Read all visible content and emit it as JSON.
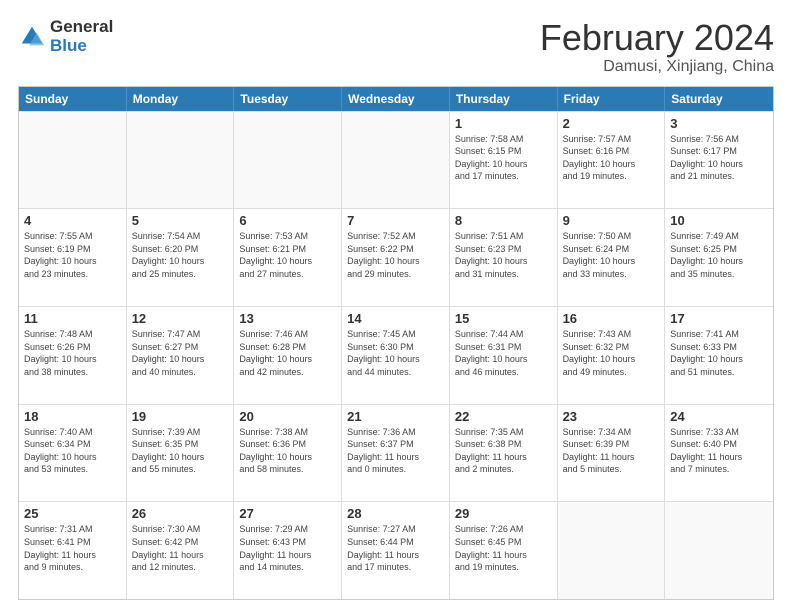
{
  "header": {
    "logo_general": "General",
    "logo_blue": "Blue",
    "title": "February 2024",
    "location": "Damusi, Xinjiang, China"
  },
  "calendar": {
    "days_of_week": [
      "Sunday",
      "Monday",
      "Tuesday",
      "Wednesday",
      "Thursday",
      "Friday",
      "Saturday"
    ],
    "weeks": [
      [
        {
          "day": "",
          "info": ""
        },
        {
          "day": "",
          "info": ""
        },
        {
          "day": "",
          "info": ""
        },
        {
          "day": "",
          "info": ""
        },
        {
          "day": "1",
          "info": "Sunrise: 7:58 AM\nSunset: 6:15 PM\nDaylight: 10 hours\nand 17 minutes."
        },
        {
          "day": "2",
          "info": "Sunrise: 7:57 AM\nSunset: 6:16 PM\nDaylight: 10 hours\nand 19 minutes."
        },
        {
          "day": "3",
          "info": "Sunrise: 7:56 AM\nSunset: 6:17 PM\nDaylight: 10 hours\nand 21 minutes."
        }
      ],
      [
        {
          "day": "4",
          "info": "Sunrise: 7:55 AM\nSunset: 6:19 PM\nDaylight: 10 hours\nand 23 minutes."
        },
        {
          "day": "5",
          "info": "Sunrise: 7:54 AM\nSunset: 6:20 PM\nDaylight: 10 hours\nand 25 minutes."
        },
        {
          "day": "6",
          "info": "Sunrise: 7:53 AM\nSunset: 6:21 PM\nDaylight: 10 hours\nand 27 minutes."
        },
        {
          "day": "7",
          "info": "Sunrise: 7:52 AM\nSunset: 6:22 PM\nDaylight: 10 hours\nand 29 minutes."
        },
        {
          "day": "8",
          "info": "Sunrise: 7:51 AM\nSunset: 6:23 PM\nDaylight: 10 hours\nand 31 minutes."
        },
        {
          "day": "9",
          "info": "Sunrise: 7:50 AM\nSunset: 6:24 PM\nDaylight: 10 hours\nand 33 minutes."
        },
        {
          "day": "10",
          "info": "Sunrise: 7:49 AM\nSunset: 6:25 PM\nDaylight: 10 hours\nand 35 minutes."
        }
      ],
      [
        {
          "day": "11",
          "info": "Sunrise: 7:48 AM\nSunset: 6:26 PM\nDaylight: 10 hours\nand 38 minutes."
        },
        {
          "day": "12",
          "info": "Sunrise: 7:47 AM\nSunset: 6:27 PM\nDaylight: 10 hours\nand 40 minutes."
        },
        {
          "day": "13",
          "info": "Sunrise: 7:46 AM\nSunset: 6:28 PM\nDaylight: 10 hours\nand 42 minutes."
        },
        {
          "day": "14",
          "info": "Sunrise: 7:45 AM\nSunset: 6:30 PM\nDaylight: 10 hours\nand 44 minutes."
        },
        {
          "day": "15",
          "info": "Sunrise: 7:44 AM\nSunset: 6:31 PM\nDaylight: 10 hours\nand 46 minutes."
        },
        {
          "day": "16",
          "info": "Sunrise: 7:43 AM\nSunset: 6:32 PM\nDaylight: 10 hours\nand 49 minutes."
        },
        {
          "day": "17",
          "info": "Sunrise: 7:41 AM\nSunset: 6:33 PM\nDaylight: 10 hours\nand 51 minutes."
        }
      ],
      [
        {
          "day": "18",
          "info": "Sunrise: 7:40 AM\nSunset: 6:34 PM\nDaylight: 10 hours\nand 53 minutes."
        },
        {
          "day": "19",
          "info": "Sunrise: 7:39 AM\nSunset: 6:35 PM\nDaylight: 10 hours\nand 55 minutes."
        },
        {
          "day": "20",
          "info": "Sunrise: 7:38 AM\nSunset: 6:36 PM\nDaylight: 10 hours\nand 58 minutes."
        },
        {
          "day": "21",
          "info": "Sunrise: 7:36 AM\nSunset: 6:37 PM\nDaylight: 11 hours\nand 0 minutes."
        },
        {
          "day": "22",
          "info": "Sunrise: 7:35 AM\nSunset: 6:38 PM\nDaylight: 11 hours\nand 2 minutes."
        },
        {
          "day": "23",
          "info": "Sunrise: 7:34 AM\nSunset: 6:39 PM\nDaylight: 11 hours\nand 5 minutes."
        },
        {
          "day": "24",
          "info": "Sunrise: 7:33 AM\nSunset: 6:40 PM\nDaylight: 11 hours\nand 7 minutes."
        }
      ],
      [
        {
          "day": "25",
          "info": "Sunrise: 7:31 AM\nSunset: 6:41 PM\nDaylight: 11 hours\nand 9 minutes."
        },
        {
          "day": "26",
          "info": "Sunrise: 7:30 AM\nSunset: 6:42 PM\nDaylight: 11 hours\nand 12 minutes."
        },
        {
          "day": "27",
          "info": "Sunrise: 7:29 AM\nSunset: 6:43 PM\nDaylight: 11 hours\nand 14 minutes."
        },
        {
          "day": "28",
          "info": "Sunrise: 7:27 AM\nSunset: 6:44 PM\nDaylight: 11 hours\nand 17 minutes."
        },
        {
          "day": "29",
          "info": "Sunrise: 7:26 AM\nSunset: 6:45 PM\nDaylight: 11 hours\nand 19 minutes."
        },
        {
          "day": "",
          "info": ""
        },
        {
          "day": "",
          "info": ""
        }
      ]
    ]
  }
}
